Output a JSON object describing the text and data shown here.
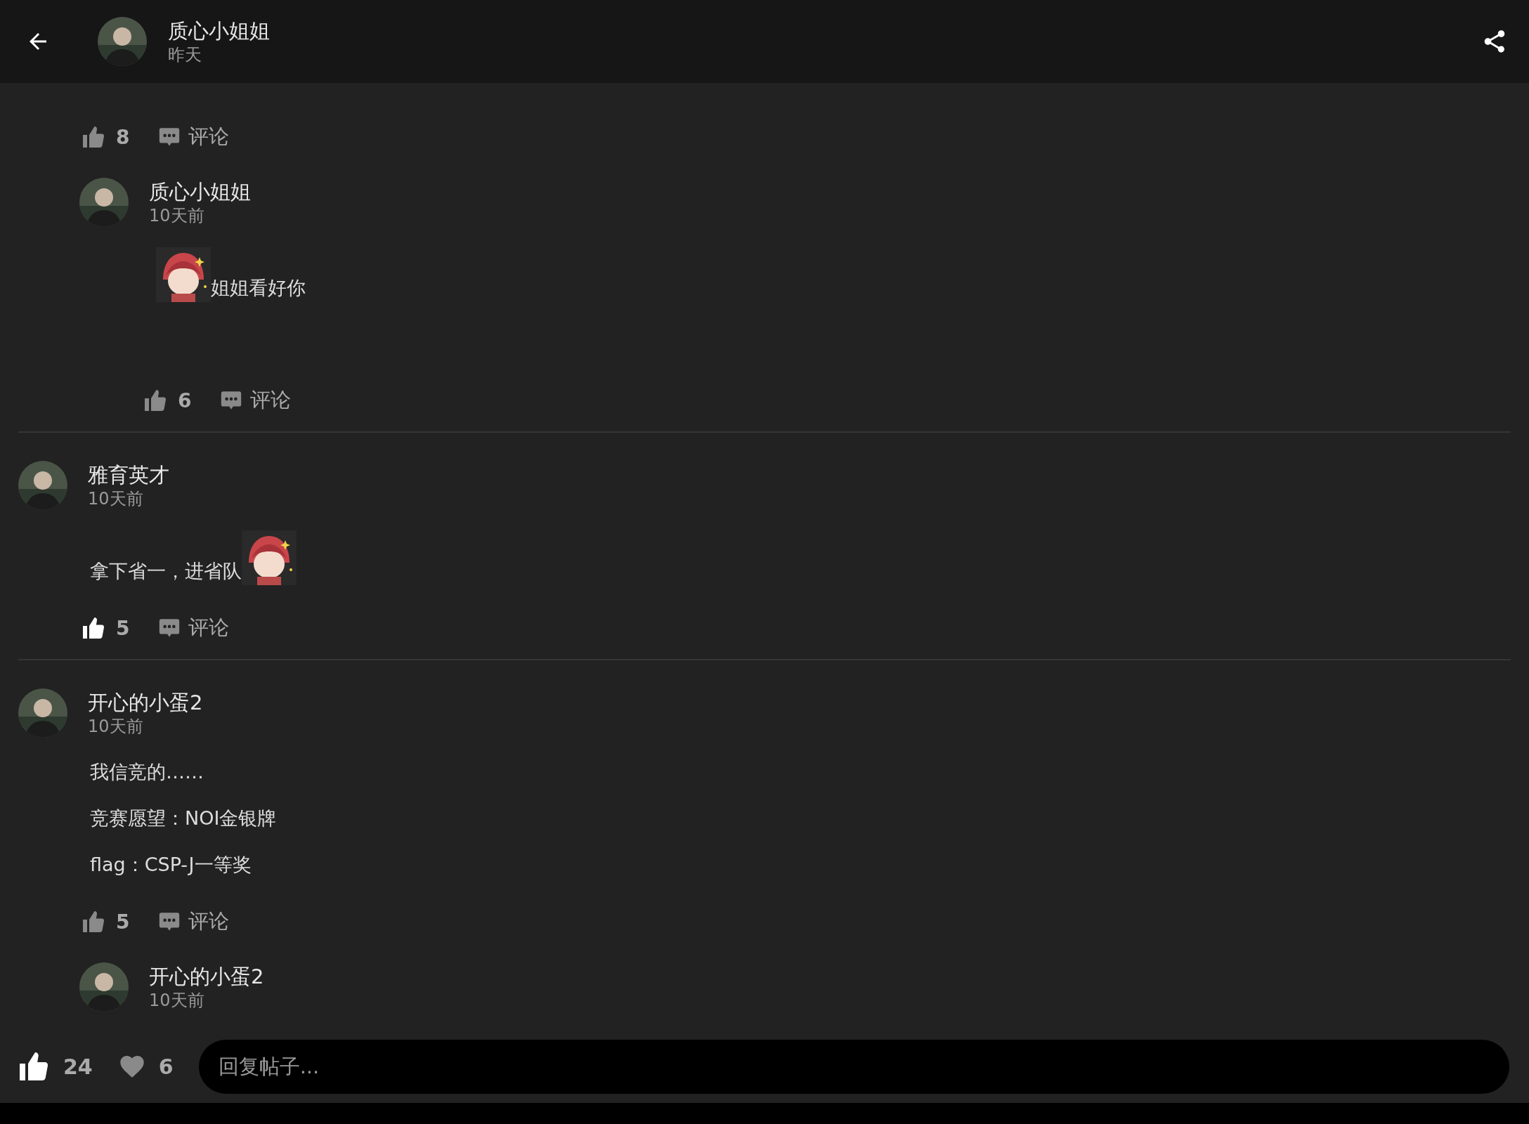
{
  "header": {
    "author": "质心小姐姐",
    "time": "昨天"
  },
  "comments": [
    {
      "likes": "8",
      "liked": false,
      "comment_label": "评论",
      "replies": [
        {
          "author": "质心小姐姐",
          "time": "10天前",
          "paragraphs": [
            [
              {
                "kind": "picture"
              },
              {
                "kind": "text",
                "text": "姐姐看好你"
              }
            ]
          ],
          "likes": "6",
          "liked": false,
          "comment_label": "评论"
        }
      ]
    },
    {
      "author": "雅育英才",
      "time": "10天前",
      "paragraphs": [
        [
          {
            "kind": "text",
            "text": "拿下省一，进省队"
          },
          {
            "kind": "picture"
          }
        ]
      ],
      "likes": "5",
      "liked": true,
      "comment_label": "评论"
    },
    {
      "author": "开心的小蛋2",
      "time": "10天前",
      "paragraphs": [
        [
          {
            "kind": "text",
            "text": "我信竞的……"
          }
        ],
        [
          {
            "kind": "text",
            "text": "竞赛愿望：NOI金银牌"
          }
        ],
        [
          {
            "kind": "text",
            "text": "flag：CSP-J一等奖"
          }
        ]
      ],
      "likes": "5",
      "liked": false,
      "comment_label": "评论",
      "replies": [
        {
          "author": "开心的小蛋2",
          "time": "10天前"
        }
      ]
    }
  ],
  "footer": {
    "likes": "24",
    "liked": true,
    "favorites": "6",
    "favorited": false,
    "reply_placeholder": "回复帖子..."
  }
}
